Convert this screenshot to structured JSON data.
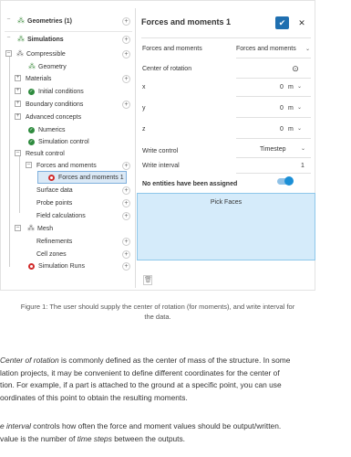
{
  "tree": {
    "geometries": "Geometries (1)",
    "simulations": "Simulations",
    "compressible": "Compressible",
    "geometry": "Geometry",
    "materials": "Materials",
    "initial_conditions": "Initial conditions",
    "boundary_conditions": "Boundary conditions",
    "advanced_concepts": "Advanced concepts",
    "numerics": "Numerics",
    "simulation_control": "Simulation control",
    "result_control": "Result control",
    "forces_and_moments": "Forces and moments",
    "forces_and_moments_1": "Forces and moments 1",
    "surface_data": "Surface data",
    "probe_points": "Probe points",
    "field_calculations": "Field calculations",
    "mesh": "Mesh",
    "refinements": "Refinements",
    "cell_zones": "Cell zones",
    "simulation_runs": "Simulation Runs"
  },
  "panel": {
    "title": "Forces and moments 1",
    "type_label": "Forces and moments",
    "type_value": "Forces and moments",
    "center_label": "Center of rotation",
    "x_label": "x",
    "y_label": "y",
    "z_label": "z",
    "x_value": "0",
    "y_value": "0",
    "z_value": "0",
    "unit": "m",
    "write_control_label": "Write control",
    "write_control_value": "Timestep",
    "write_interval_label": "Write interval",
    "write_interval_value": "1",
    "no_entities": "No entities have been assigned",
    "pick_faces": "Pick Faces"
  },
  "caption": {
    "line1": "Figure 1: The user should supply the center of rotation (for moments), and write interval for",
    "line2": "the data."
  },
  "text": {
    "p1a_term": "Center of rotation",
    "p1a_rest": " is commonly defined as the center of mass of the structure. In some",
    "p1b": "lation projects, it may be convenient to define different coordinates for the center of",
    "p1c": "tion. For example, if a part is attached to the ground at a specific point, you can use",
    "p1d": "oordinates of this point to obtain the resulting moments.",
    "p2a_term": "e interval",
    "p2a_rest": " controls how often the force and moment values should be output/written.",
    "p2b_start": "value is the number of ",
    "p2b_term": "time steps",
    "p2b_end": " between the outputs."
  }
}
